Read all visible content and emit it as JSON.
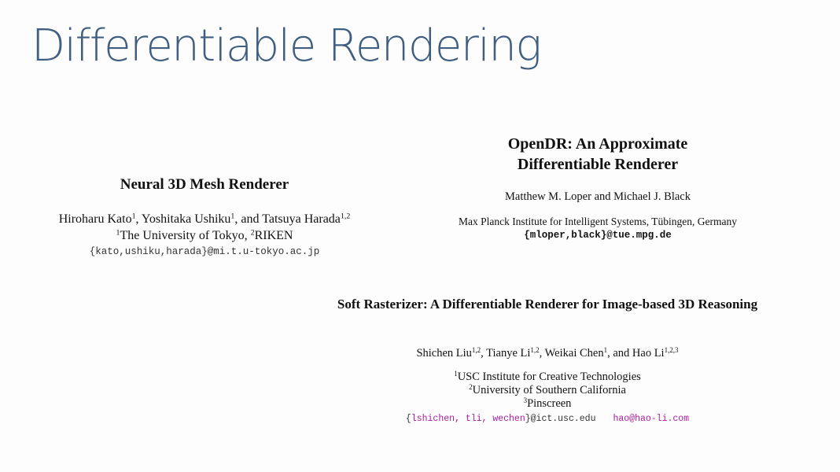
{
  "slide": {
    "title": "Differentiable Rendering"
  },
  "papers": {
    "nmr": {
      "title": "Neural 3D Mesh Renderer",
      "authors": [
        {
          "name": "Hiroharu Kato",
          "sup": "1",
          "sep": ", "
        },
        {
          "name": "Yoshitaka Ushiku",
          "sup": "1",
          "sep": ", and "
        },
        {
          "name": "Tatsuya Harada",
          "sup": "1,2",
          "sep": ""
        }
      ],
      "affiliations": [
        {
          "sup": "1",
          "name": "The University of Tokyo",
          "sep": ", "
        },
        {
          "sup": "2",
          "name": "RIKEN",
          "sep": ""
        }
      ],
      "email": "{kato,ushiku,harada}@mi.t.u-tokyo.ac.jp"
    },
    "opendr": {
      "title_line1": "OpenDR: An Approximate",
      "title_line2": "Differentiable Renderer",
      "authors": "Matthew M. Loper and Michael J. Black",
      "affiliation": "Max Planck Institute for Intelligent Systems, Tübingen, Germany",
      "email": "{mloper,black}@tue.mpg.de"
    },
    "softras": {
      "title": "Soft Rasterizer: A Differentiable Renderer for Image-based 3D Reasoning",
      "authors": [
        {
          "name": "Shichen Liu",
          "sup": "1,2",
          "sep": ", "
        },
        {
          "name": "Tianye Li",
          "sup": "1,2",
          "sep": ", "
        },
        {
          "name": "Weikai Chen",
          "sup": "1",
          "sep": ", and "
        },
        {
          "name": "Hao Li",
          "sup": "1,2,3",
          "sep": ""
        }
      ],
      "affiliations": [
        {
          "sup": "1",
          "name": "USC Institute for Creative Technologies"
        },
        {
          "sup": "2",
          "name": "University of Southern California"
        },
        {
          "sup": "3",
          "name": "Pinscreen"
        }
      ],
      "email_open_brace": "{",
      "email_users": "lshichen, tli, wechen",
      "email_close_domain": "}@ict.usc.edu",
      "email_second": "hao@hao-li.com"
    }
  }
}
